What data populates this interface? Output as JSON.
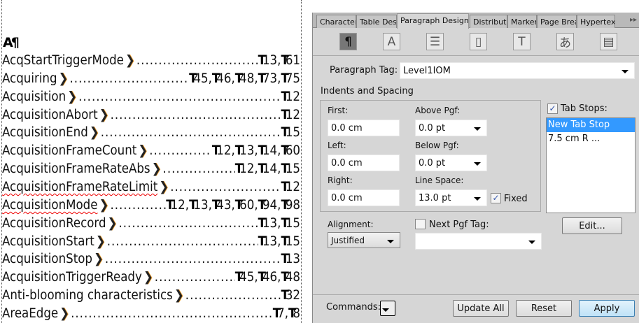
{
  "document": {
    "marker": "A¶",
    "entries": [
      {
        "term": "AcqStartTriggerMode",
        "pages": [
          "13",
          "61"
        ]
      },
      {
        "term": "Acquiring",
        "pages": [
          "45",
          "46",
          "48",
          "73",
          "75"
        ]
      },
      {
        "term": "Acquisition",
        "pages": [
          "12"
        ]
      },
      {
        "term": "AcquisitionAbort",
        "pages": [
          "12"
        ]
      },
      {
        "term": "AcquisitionEnd",
        "pages": [
          "15"
        ]
      },
      {
        "term": "AcquisitionFrameCount",
        "pages": [
          "12",
          "13",
          "14",
          "60"
        ]
      },
      {
        "term": "AcquisitionFrameRateAbs",
        "pages": [
          "12",
          "14",
          "15"
        ]
      },
      {
        "term": "AcquisitionFrameRateLimit",
        "pages": [
          "12"
        ]
      },
      {
        "term": "AcquisitionMode",
        "pages": [
          "12",
          "13",
          "43",
          "60",
          "94",
          "98"
        ]
      },
      {
        "term": "AcquisitionRecord",
        "pages": [
          "13",
          "15"
        ]
      },
      {
        "term": "AcquisitionStart",
        "pages": [
          "13",
          "15"
        ]
      },
      {
        "term": "AcquisitionStop",
        "pages": [
          "13"
        ]
      },
      {
        "term": "AcquisitionTriggerReady",
        "pages": [
          "45",
          "46",
          "48"
        ]
      },
      {
        "term": "Anti-blooming characteristics",
        "pages": [
          "32"
        ]
      },
      {
        "term": "AreaEdge",
        "pages": [
          "7",
          "8"
        ]
      }
    ]
  },
  "panel": {
    "tabs": [
      "Character D",
      "Table Desig",
      "Paragraph Designer",
      "Distribute",
      "Marker",
      "Page Break",
      "Hypertext"
    ],
    "active_tab": "Paragraph Designer",
    "icons": [
      "paragraph-icon",
      "font-icon",
      "pagination-icon",
      "numbering-icon",
      "advanced-icon",
      "asian-icon",
      "table-cell-icon"
    ],
    "paragraph_tag_label": "Paragraph Tag:",
    "paragraph_tag": "Level1IOM",
    "indents_title": "Indents and Spacing",
    "first_label": "First:",
    "first": "0.0 cm",
    "left_label": "Left:",
    "left": "0.0 cm",
    "right_label": "Right:",
    "right": "0.0 cm",
    "above_label": "Above Pgf:",
    "above": "0.0 pt",
    "below_label": "Below Pgf:",
    "below": "0.0 pt",
    "linespace_label": "Line Space:",
    "linespace": "13.0 pt",
    "fixed_label": "Fixed",
    "fixed_checked": true,
    "tabstops_label": "Tab Stops:",
    "tabstops_checked": true,
    "tabstops": [
      "New Tab Stop",
      "7.5 cm  R  ..."
    ],
    "edit_label": "Edit...",
    "alignment_label": "Alignment:",
    "alignment": "Justified",
    "nextpgf_label": "Next Pgf Tag:",
    "nextpgf_checked": false,
    "nextpgf": "",
    "commands_label": "Commands:",
    "update_all": "Update All",
    "reset": "Reset",
    "apply": "Apply"
  }
}
